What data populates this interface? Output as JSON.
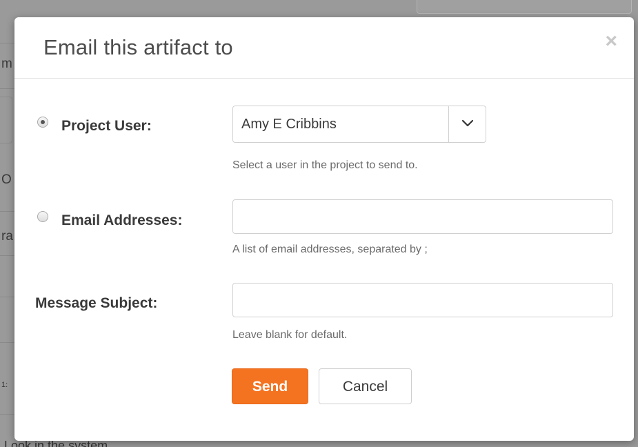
{
  "background": {
    "fragments": [
      "m",
      "O",
      "ra",
      "1:"
    ],
    "bottom_text": "Look in the system"
  },
  "dialog": {
    "title": "Email this artifact to",
    "close_glyph": "×",
    "project_user": {
      "label": "Project User:",
      "selected": "Amy E Cribbins",
      "help": "Select a user in the project to send to.",
      "checked": true
    },
    "email_addresses": {
      "label": "Email Addresses:",
      "value": "",
      "help": "A list of email addresses, separated by ;",
      "checked": false
    },
    "message_subject": {
      "label": "Message Subject:",
      "value": "",
      "help": "Leave blank for default."
    },
    "buttons": {
      "send": "Send",
      "cancel": "Cancel"
    }
  },
  "colors": {
    "accent": "#f47321",
    "overlay": "#9a9a9a"
  },
  "icons": {
    "close": "close-icon",
    "dropdown": "chevron-down-icon"
  }
}
